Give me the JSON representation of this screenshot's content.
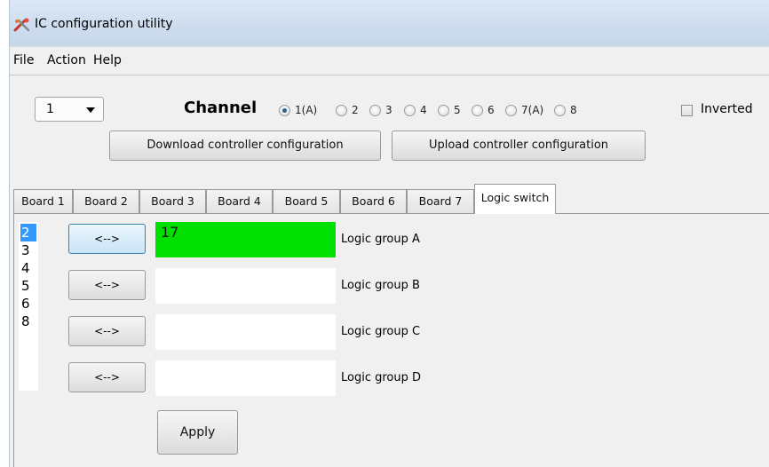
{
  "window": {
    "title": "IC configuration utility",
    "icon": "tools-icon"
  },
  "menu": [
    "File",
    "Action",
    "Help"
  ],
  "controller_select": {
    "value": "1"
  },
  "channel": {
    "label": "Channel",
    "options": [
      "1(A)",
      "2",
      "3",
      "4",
      "5",
      "6",
      "7(A)",
      "8"
    ],
    "selected": "1(A)"
  },
  "inverted": {
    "label": "Inverted",
    "checked": false
  },
  "buttons": {
    "download": "Download controller configuration",
    "upload": "Upload controller configuration",
    "apply": "Apply"
  },
  "tabs": {
    "items": [
      "Board 1",
      "Board 2",
      "Board 3",
      "Board 4",
      "Board 5",
      "Board 6",
      "Board 7",
      "Logic switch"
    ],
    "active": "Logic switch"
  },
  "logic_switch": {
    "list": [
      "2",
      "3",
      "4",
      "5",
      "6",
      "8"
    ],
    "selected": "2",
    "swap_label": "<-->",
    "groups": [
      {
        "label": "Logic group A",
        "value": "17",
        "highlight_color": "#00e000"
      },
      {
        "label": "Logic group B",
        "value": ""
      },
      {
        "label": "Logic group C",
        "value": ""
      },
      {
        "label": "Logic group D",
        "value": ""
      }
    ]
  }
}
